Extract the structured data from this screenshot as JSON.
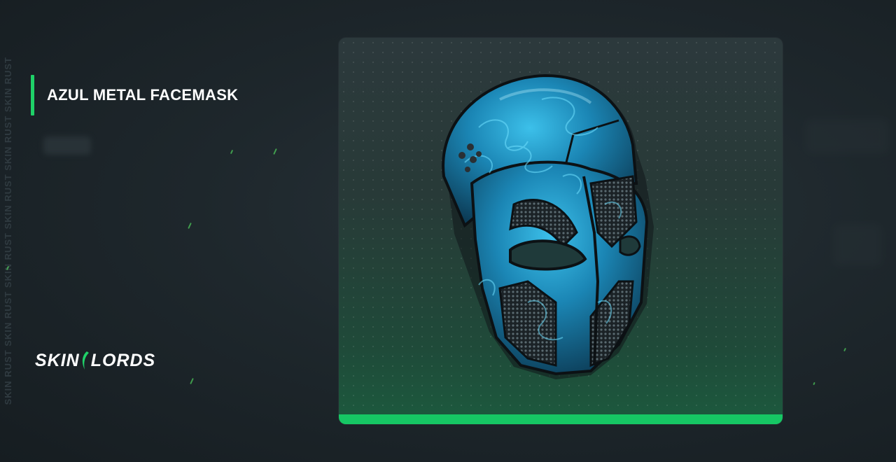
{
  "item": {
    "title": "AZUL METAL FACEMASK"
  },
  "sidebar": {
    "vertical_text": "SKIN RUST SKIN RUST SKIN RUST SKIN RUST SKIN RUST SKIN RUST"
  },
  "logo": {
    "left": "SKIN",
    "right": "LORDS",
    "mark_icon": "leaf-icon"
  },
  "colors": {
    "accent": "#1fd168",
    "card_bar": "#16c764",
    "mask_blue": "#1a8fc4"
  }
}
